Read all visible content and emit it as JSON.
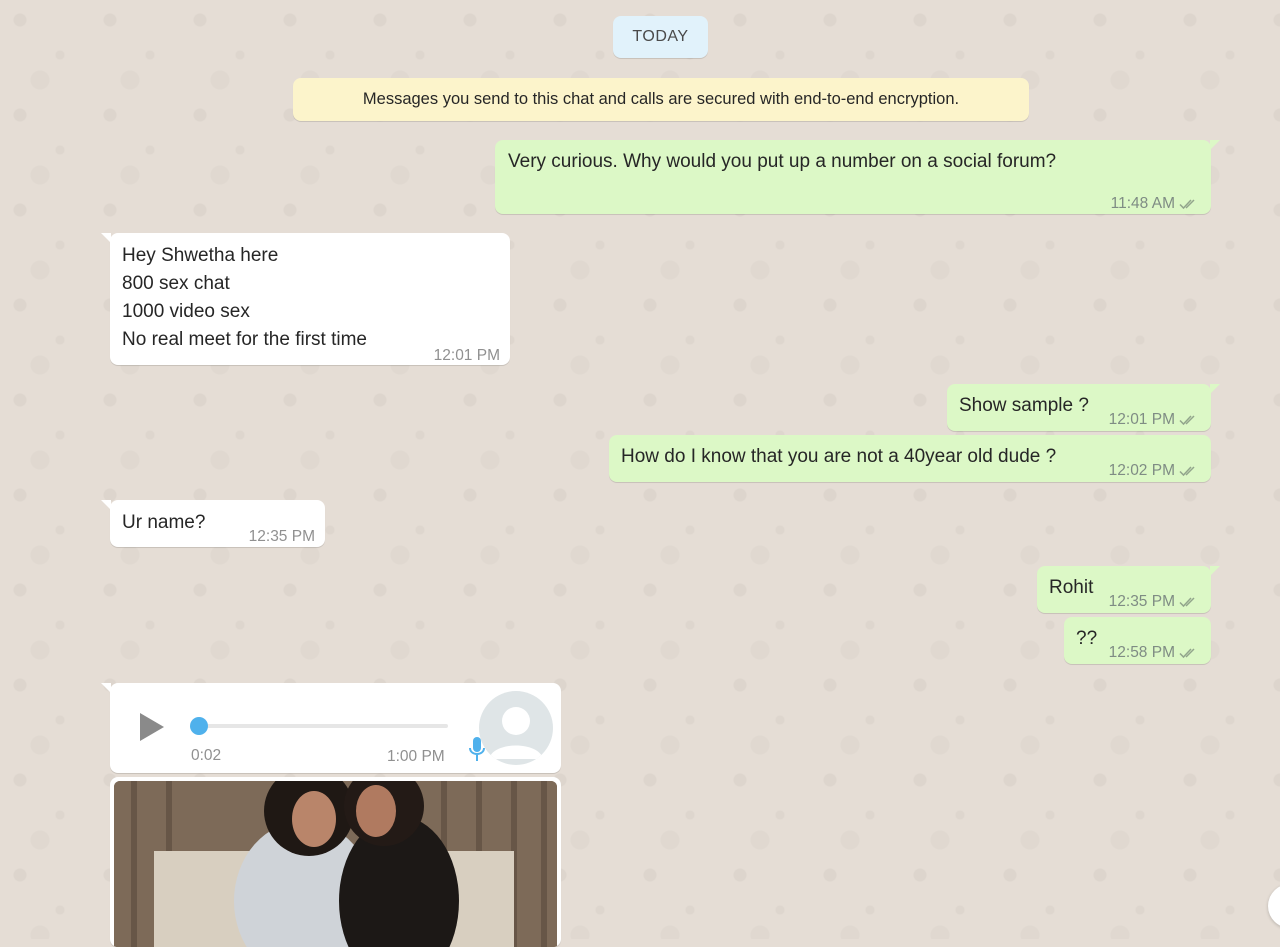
{
  "date_chip": "TODAY",
  "encryption_notice": "Messages you send to this chat and calls are secured with end-to-end encryption.",
  "messages": [
    {
      "dir": "out",
      "lines": [
        "Very curious. Why would you put up a number on a social forum?"
      ],
      "time": "11:48 AM",
      "ticks": "double-check-icon"
    },
    {
      "dir": "in",
      "lines": [
        "Hey Shwetha here",
        "800 sex chat",
        "1000 video sex",
        "No real meet for the first time"
      ],
      "time": "12:01 PM"
    },
    {
      "dir": "out",
      "lines": [
        "Show sample ?"
      ],
      "time": "12:01 PM",
      "ticks": "double-check-icon"
    },
    {
      "dir": "out",
      "lines": [
        "How do I know that you are not a 40year old dude ?"
      ],
      "time": "12:02 PM",
      "ticks": "double-check-icon"
    },
    {
      "dir": "in",
      "lines": [
        "Ur name?"
      ],
      "time": "12:35 PM"
    },
    {
      "dir": "out",
      "lines": [
        "Rohit"
      ],
      "time": "12:35 PM",
      "ticks": "double-check-icon"
    },
    {
      "dir": "out",
      "lines": [
        "??"
      ],
      "time": "12:58 PM",
      "ticks": "double-check-icon"
    }
  ],
  "voice_note": {
    "duration": "0:02",
    "time": "1:00 PM",
    "progress": 0,
    "icons": [
      "play-icon",
      "microphone-icon",
      "avatar-icon"
    ]
  },
  "image_message": {
    "icon": "photo-thumbnail"
  },
  "colors": {
    "background": "#e5ddd5",
    "outgoing_bubble": "#dcf8c6",
    "incoming_bubble": "#ffffff",
    "notice": "#fcf4cb",
    "date_chip": "#e1f2fb",
    "accent": "#4fb1ec"
  }
}
